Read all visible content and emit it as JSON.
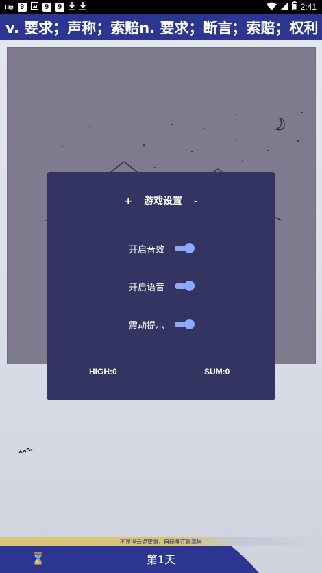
{
  "status_bar": {
    "tap_label": "Tap",
    "badges": [
      "9",
      "9",
      "9"
    ],
    "time": "2:41",
    "icons": [
      "image-icon",
      "download-icon",
      "download-icon",
      "wifi-icon",
      "signal-icon",
      "battery-icon"
    ]
  },
  "word_bar": {
    "text": "v. 要求；声称；索赔n. 要求；断言；索赔；权利"
  },
  "settings": {
    "title": "游戏设置",
    "plus_label": "+",
    "minus_label": "-",
    "options": [
      {
        "label": "开启音效",
        "on": true
      },
      {
        "label": "开启语音",
        "on": true
      },
      {
        "label": "震动提示",
        "on": true
      }
    ],
    "high": "HIGH:0",
    "sum": "SUM:0"
  },
  "banner": {
    "text": "不畏浮云遮望眼，自缘身在最高层"
  },
  "bottom": {
    "hourglass": "⌛",
    "day": "第1天"
  },
  "colors": {
    "word_bar_bg": "#2c3590",
    "modal_bg": "#333462",
    "toggle_on": "#8aa9ff",
    "game_bg": "#7d7b8d"
  }
}
